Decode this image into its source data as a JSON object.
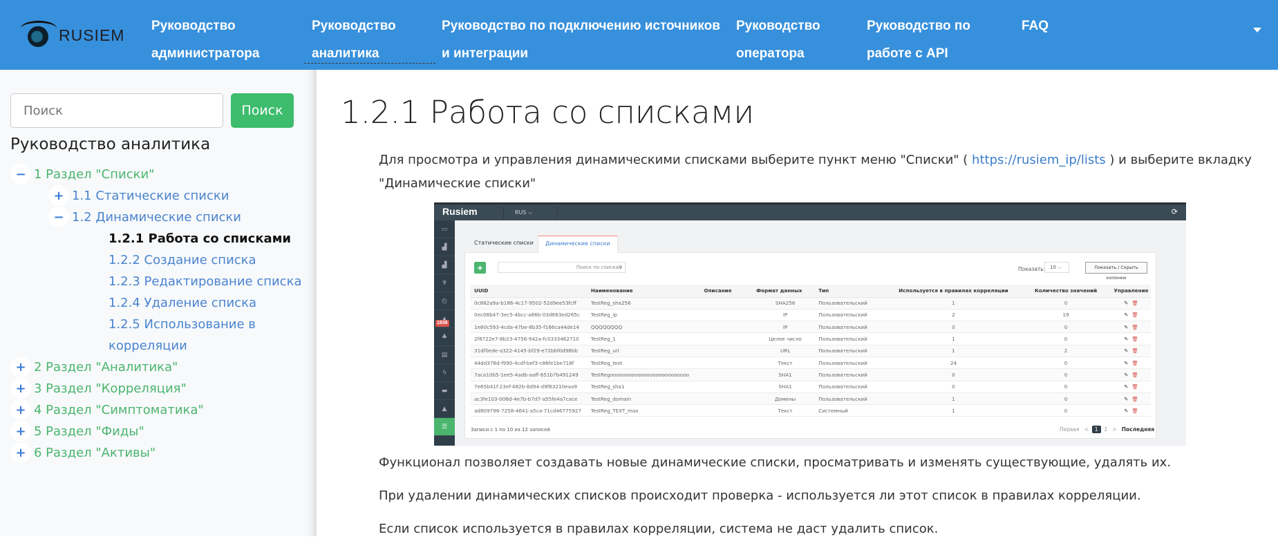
{
  "header": {
    "logo_text": "RUSIEM",
    "brand_color": "#3790dc",
    "nav": [
      {
        "line1": "Руководство",
        "line2": "администратора"
      },
      {
        "line1": "Руководство",
        "line2": "аналитика",
        "active": true
      },
      {
        "line1": "Руководство по подключению источников",
        "line2": "и интеграции"
      },
      {
        "line1": "Руководство",
        "line2": "оператора"
      },
      {
        "line1": "Руководство по",
        "line2": "работе с API"
      },
      {
        "line1": "FAQ",
        "line2": ""
      }
    ],
    "dropdown_icon": "caret-down-icon"
  },
  "sidebar": {
    "search_placeholder": "Поиск",
    "search_button": "Поиск",
    "title": "Руководство аналитика",
    "tree": [
      {
        "toggle": "−",
        "label": "1 Раздел \"Списки\""
      },
      {
        "toggle": "+",
        "label": "1.1 Статические списки"
      },
      {
        "toggle": "−",
        "label": "1.2 Динамические списки"
      },
      {
        "label": "1.2.1 Работа со списками",
        "current": true
      },
      {
        "label": "1.2.2 Создание списка"
      },
      {
        "label": "1.2.3 Редактирование списка"
      },
      {
        "label": "1.2.4 Удаление списка"
      },
      {
        "label": "1.2.5 Использование в",
        "label2": "корреляции"
      },
      {
        "toggle": "+",
        "label": "2 Раздел \"Аналитика\""
      },
      {
        "toggle": "+",
        "label": "3 Раздел \"Корреляция\""
      },
      {
        "toggle": "+",
        "label": "4 Раздел \"Симптоматика\""
      },
      {
        "toggle": "+",
        "label": "5 Раздел \"Фиды\""
      },
      {
        "toggle": "+",
        "label": "6 Раздел \"Активы\""
      }
    ]
  },
  "main": {
    "title": "1.2.1 Работа со списками",
    "intro_a": "Для  просмотра  и  управления  динамическими списками  выберите пункт меню  \"Списки\"  (",
    "intro_link": "https://rusiem_ip/lists",
    "intro_b": ")  и  выберите  вкладку",
    "intro_c": "\"Динамические списки\"",
    "paragraphs": [
      "Функционал позволяет создавать новые динамические списки, просматривать и изменять существующие, удалять их.",
      "При удалении динамических списков происходит проверка - используется ли этот список в правилах корреляции.",
      "Если список используется в правилах корреляции, система не даст удалить список."
    ]
  },
  "screenshot": {
    "logo": "Rusiem",
    "lang": "RUS ⌵",
    "badge": "1838",
    "tabs": [
      "Статические списки",
      "Динамические списки"
    ],
    "search_placeholder": "Поиск по спискам",
    "show_label": "Показать:",
    "show_value": "10",
    "columns_button": "Показать / Скрыть колонки",
    "headers": [
      "UUID",
      "Наименование",
      "Описание",
      "Формат данных",
      "Тип",
      "Используется в правилах корреляции",
      "Количество значений",
      "Управление"
    ],
    "rows": [
      [
        "0c882a9a-b186-4c17-9502-52d9ee53fcff",
        "TestReg_sha256",
        "",
        "SHA256",
        "Пользовательский",
        "1",
        "0"
      ],
      [
        "0ec08b47-3ec5-4bcc-a86b-03d683ed265c",
        "TestReg_ip",
        "",
        "IP",
        "Пользовательский",
        "2",
        "19"
      ],
      [
        "1e60c593-4cda-47be-8b35-f166ca44de14",
        "QQQQQQQQ",
        "",
        "IP",
        "Пользовательский",
        "0",
        "0"
      ],
      [
        "2f8722e7-8b23-4756-942a-fc0333462710",
        "TestReg_1",
        "",
        "Целое число",
        "Пользовательский",
        "1",
        "0"
      ],
      [
        "31df0ede-a322-4145-bf29-e72bbf0d98bb",
        "TestReg_url",
        "",
        "URL",
        "Пользовательский",
        "1",
        "2"
      ],
      [
        "44dd378d-f990-4cdf-bef3-c86fe1be718f",
        "TestReg_text",
        "",
        "Текст",
        "Пользовательский",
        "24",
        "0"
      ],
      [
        "7aca10b5-1ee5-4adb-aaff-651b7b491249",
        "TestRegoooooooooooooooooooooooooo",
        "",
        "SHA1",
        "Пользовательский",
        "0",
        "0"
      ],
      [
        "7e65b41f-23ef-482b-8d94-d9f63210eaa9",
        "TestReg_sha1",
        "",
        "SHA1",
        "Пользовательский",
        "0",
        "0"
      ],
      [
        "ac3fe103-006d-4e7b-b7d7-a55fe4a7cace",
        "TestReg_domain",
        "",
        "Домены",
        "Пользовательский",
        "1",
        "0"
      ],
      [
        "ad809796-7258-4641-a5ca-71cd46775927",
        "TestReg_TEXT_max",
        "",
        "Текст",
        "Системный",
        "1",
        "0"
      ]
    ],
    "footer": "Записи с 1 по 10 из 12 записей",
    "pagination": {
      "first": "Первая",
      "prev": "<",
      "pages": [
        "1",
        "2"
      ],
      "next": ">",
      "last": "Последняя",
      "current": "1"
    }
  }
}
